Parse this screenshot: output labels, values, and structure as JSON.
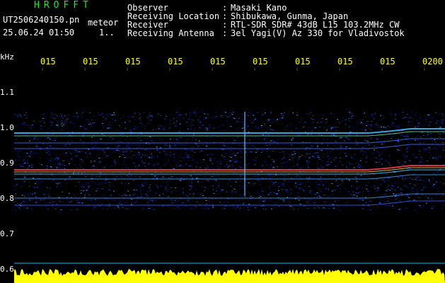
{
  "app_title": "HROFFT",
  "file_name": "UT2506240150.pn",
  "mode_label": "meteor",
  "datetime": "25.06.24 01:50",
  "counter": "1..",
  "info": [
    {
      "label": "Observer",
      "sep": ":",
      "value": "Masaki Kano"
    },
    {
      "label": "Receiving Location",
      "sep": ":",
      "value": "Shibukawa, Gunma, Japan"
    },
    {
      "label": "Receiver",
      "sep": ":",
      "value": "RTL-SDR SDR# 43dB L15 103.2MHz CW"
    },
    {
      "label": "Receiving Antenna",
      "sep": ":",
      "value": "3el Yagi(V) Az 330 for Vladivostok"
    }
  ],
  "axis": {
    "unit": "kHz",
    "y_ticks": [
      "1.1",
      "1.0",
      "0.9",
      "0.8",
      "0.7",
      "0.6"
    ],
    "x_ticks": [
      "015",
      "015",
      "015",
      "015",
      "015",
      "015",
      "015",
      "015",
      "015",
      "0200"
    ]
  },
  "colors": {
    "title": "#00ff00",
    "x_ticks": "#ffff00",
    "signal_trace": "#ffff00"
  }
}
